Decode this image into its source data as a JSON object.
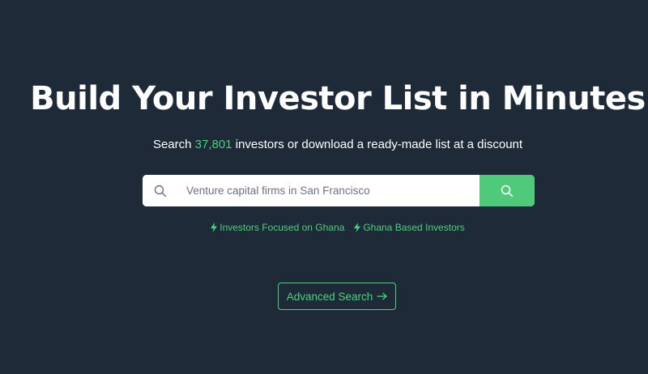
{
  "hero": {
    "title": "Build Your Investor List in Minutes",
    "subtitle_prefix": "Search ",
    "investor_count": "37,801",
    "subtitle_suffix": " investors or download a ready-made list at a discount"
  },
  "search": {
    "placeholder": "Venture capital firms in San Francisco",
    "value": "",
    "leading_icon": "search-icon",
    "button_icon": "search-icon"
  },
  "quick_links": [
    {
      "icon": "lightning-bolt-icon",
      "label": "Investors Focused on Ghana"
    },
    {
      "icon": "lightning-bolt-icon",
      "label": "Ghana Based Investors"
    }
  ],
  "advanced_search": {
    "label": "Advanced Search",
    "icon": "arrow-right-icon"
  },
  "colors": {
    "background": "#1e2a38",
    "accent": "#4cd07d",
    "search_button": "#4fc97a",
    "text": "#ffffff"
  }
}
